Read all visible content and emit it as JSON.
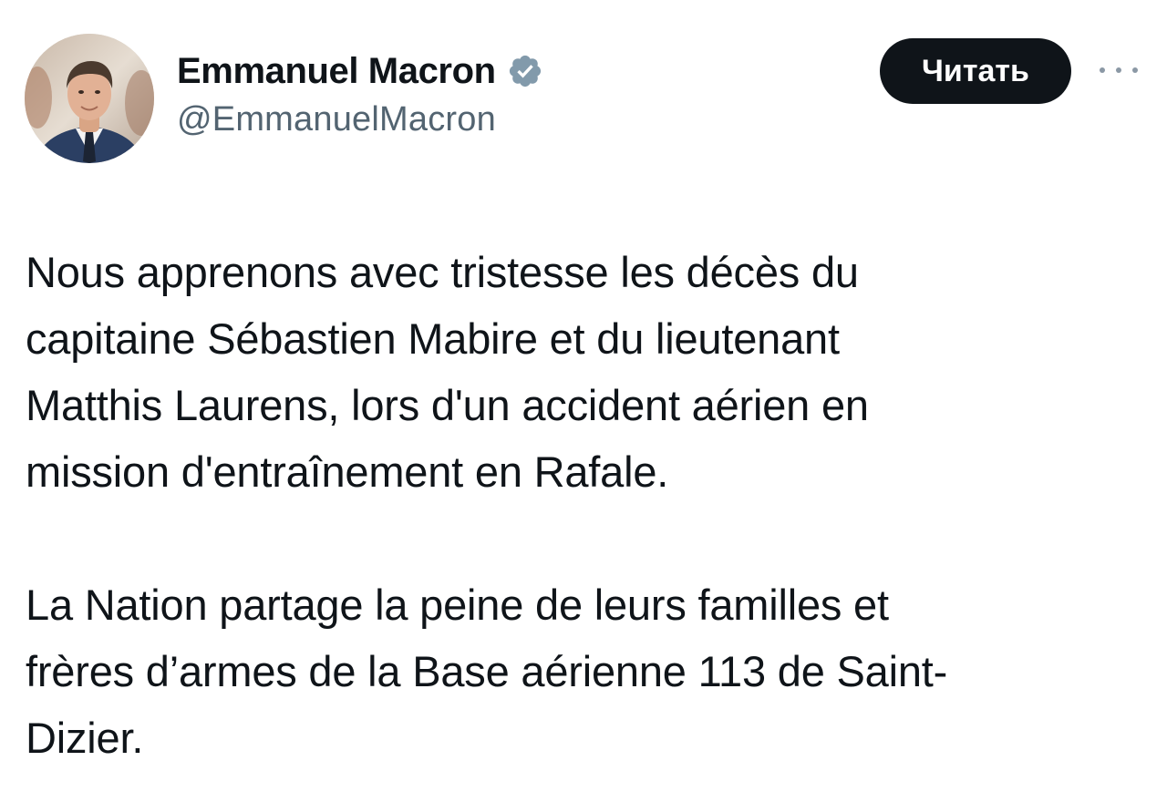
{
  "author": {
    "display_name": "Emmanuel Macron",
    "handle": "@EmmanuelMacron",
    "verified": true,
    "verified_badge_color": "#829aab"
  },
  "actions": {
    "follow_label": "Читать"
  },
  "icons": {
    "verified": "verified-badge-icon",
    "more": "more-options-icon",
    "avatar": "profile-photo"
  },
  "tweet": {
    "paragraphs": [
      "Nous apprenons avec tristesse les décès du\ncapitaine Sébastien Mabire et du lieutenant\nMatthis Laurens, lors d'un accident aérien en\nmission d'entraînement en Rafale.",
      "La Nation partage la peine de leurs familles et\nfrères d’armes de la Base aérienne 113 de Saint-\nDizier."
    ]
  },
  "colors": {
    "text": "#0f1419",
    "secondary_text": "#536471",
    "button_bg": "#0f1419",
    "button_text": "#ffffff"
  }
}
